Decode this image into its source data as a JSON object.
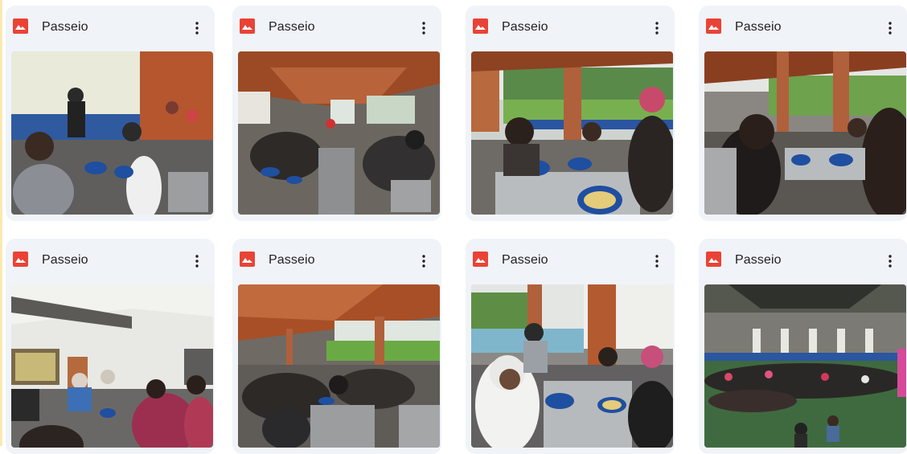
{
  "cards": [
    {
      "title": "Passeio",
      "scene": "cafeteria-blue"
    },
    {
      "title": "Passeio",
      "scene": "hall-roof"
    },
    {
      "title": "Passeio",
      "scene": "outdoor-field"
    },
    {
      "title": "Passeio",
      "scene": "outdoor-field-2"
    },
    {
      "title": "Passeio",
      "scene": "indoor-kitchen"
    },
    {
      "title": "Passeio",
      "scene": "hall-roof-2"
    },
    {
      "title": "Passeio",
      "scene": "outdoor-kids"
    },
    {
      "title": "Passeio",
      "scene": "gym"
    }
  ],
  "colors": {
    "card_bg": "#f0f4f9",
    "image_icon": "#ea4335",
    "text": "#1f1f1f"
  },
  "icons": {
    "file_type": "image-file-icon",
    "menu": "more-vert-icon"
  }
}
